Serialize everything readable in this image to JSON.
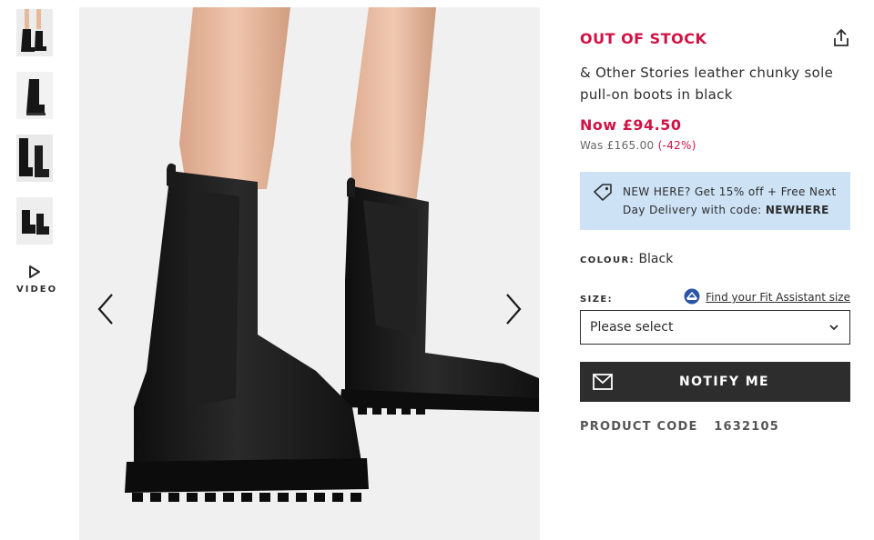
{
  "gallery": {
    "thumbnails": [
      {
        "icon": "boots-front-thumbnail"
      },
      {
        "icon": "boot-side-thumbnail"
      },
      {
        "icon": "boots-pair-thumbnail"
      },
      {
        "icon": "boots-top-thumbnail"
      }
    ],
    "video_label": "VIDEO",
    "prev_icon": "chevron-left-icon",
    "next_icon": "chevron-right-icon"
  },
  "product": {
    "stock_status": "OUT OF STOCK",
    "title": "& Other Stories leather chunky sole pull-on boots in black",
    "price_now": "Now £94.50",
    "price_was": "Was £165.00",
    "discount": "(-42%)",
    "colour_label": "COLOUR:",
    "colour_value": "Black",
    "size_label": "SIZE:",
    "fit_assistant_link": "Find your Fit Assistant size",
    "size_select_value": "Please select",
    "notify_button": "NOTIFY ME",
    "product_code_label": "PRODUCT CODE",
    "product_code_value": "1632105"
  },
  "promo": {
    "text": "NEW HERE? Get 15% off + Free Next Day Delivery with code:",
    "code": "NEWHERE"
  },
  "colors": {
    "accent_red": "#d01345",
    "promo_bg": "#cde2f5",
    "button_dark": "#2d2d2d"
  }
}
